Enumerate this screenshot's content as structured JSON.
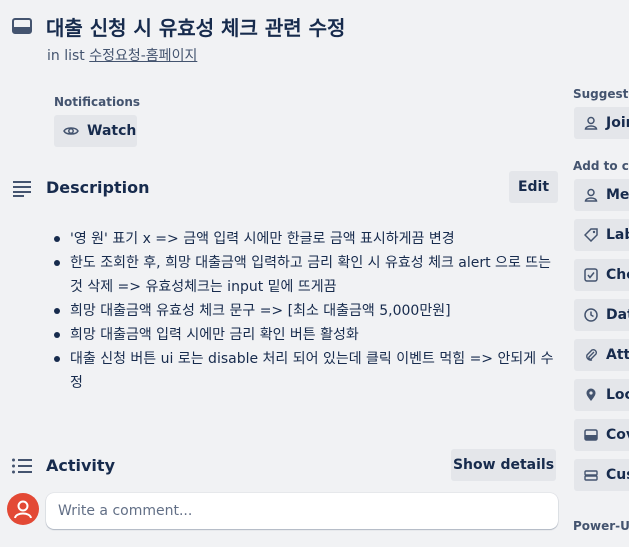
{
  "card": {
    "title": "대출 신청 시 유효성 체크 관련 수정",
    "in_list_prefix": "in list",
    "list_name": "수정요청-홈페이지"
  },
  "notifications": {
    "label": "Notifications",
    "watch_label": "Watch"
  },
  "description": {
    "title": "Description",
    "edit_label": "Edit",
    "items": [
      "'영 원' 표기 x => 금액 입력 시에만 한글로 금액 표시하게끔 변경",
      "한도 조회한 후, 희망 대출금액 입력하고 금리 확인 시 유효성 체크 alert 으로 뜨는 것 삭제 => 유효성체크는 input 밑에 뜨게끔",
      "희망 대출금액 유효성 체크 문구 => [최소 대출금액 5,000만원]",
      "희망 대출금액 입력 시에만 금리 확인 버튼 활성화",
      "대출 신청 버튼 ui 로는 disable 처리 되어 있는데 클릭 이벤트 먹힘 => 안되게 수정"
    ]
  },
  "activity": {
    "title": "Activity",
    "show_details_label": "Show details",
    "comment_placeholder": "Write a comment..."
  },
  "sidebar": {
    "suggested_label": "Suggested",
    "suggested_items": [
      {
        "label": "Join",
        "icon": "person-icon"
      }
    ],
    "add_to_card_label": "Add to card",
    "add_items": [
      {
        "label": "Members",
        "icon": "person-icon"
      },
      {
        "label": "Labels",
        "icon": "tag-icon"
      },
      {
        "label": "Checklist",
        "icon": "checkbox-icon"
      },
      {
        "label": "Dates",
        "icon": "clock-icon"
      },
      {
        "label": "Attachment",
        "icon": "paperclip-icon"
      },
      {
        "label": "Location",
        "icon": "location-pin-icon"
      },
      {
        "label": "Cover",
        "icon": "cover-icon"
      },
      {
        "label": "Custom Fields",
        "icon": "custom-fields-icon"
      }
    ],
    "power_ups_label": "Power-Ups"
  },
  "colors": {
    "background": "#f1f2f4",
    "button": "#e4e6ea",
    "text": "#172b4d",
    "subtle_text": "#44546f",
    "avatar": "#e34935"
  }
}
